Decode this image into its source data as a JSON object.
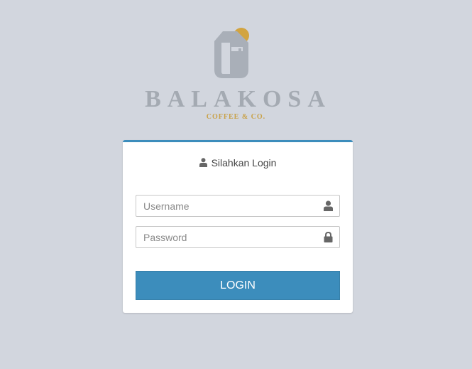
{
  "brand": {
    "name": "BALAKOSA",
    "tagline": "COFFEE & CO."
  },
  "login_box": {
    "title": "Silahkan Login",
    "title_icon": "user-icon",
    "accent_color": "#3c8dbc"
  },
  "form": {
    "username": {
      "placeholder": "Username",
      "value": "",
      "icon": "user-icon"
    },
    "password": {
      "placeholder": "Password",
      "value": "",
      "icon": "lock-icon"
    },
    "submit_label": "LOGIN"
  },
  "colors": {
    "background": "#d2d6de",
    "logo_gray": "#a4aab2",
    "logo_gold": "#c9a24a",
    "button": "#3c8dbc"
  }
}
